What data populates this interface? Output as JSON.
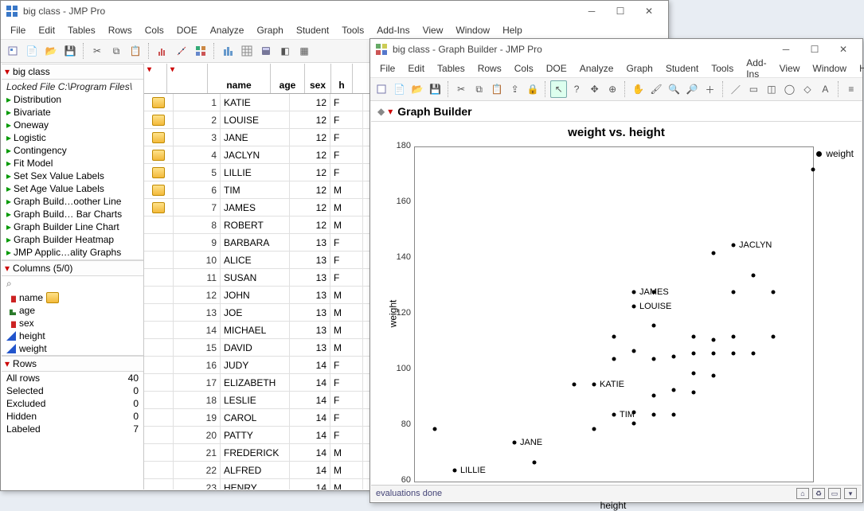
{
  "main_window": {
    "title": "big class - JMP Pro",
    "menus": [
      "File",
      "Edit",
      "Tables",
      "Rows",
      "Cols",
      "DOE",
      "Analyze",
      "Graph",
      "Student",
      "Tools",
      "Add-Ins",
      "View",
      "Window",
      "Help"
    ],
    "table_panel_title": "big class",
    "locked_note": "Locked File   C:\\Program Files\\",
    "scripts": [
      "Distribution",
      "Bivariate",
      "Oneway",
      "Logistic",
      "Contingency",
      "Fit Model",
      "Set Sex Value Labels",
      "Set Age Value Labels",
      "Graph Build…oother Line",
      "Graph Build… Bar Charts",
      "Graph Builder Line Chart",
      "Graph Builder Heatmap",
      "JMP Applic…ality Graphs"
    ],
    "columns_header": "Columns (5/0)",
    "columns": [
      {
        "name": "name",
        "type": "red",
        "label": true
      },
      {
        "name": "age",
        "type": "green"
      },
      {
        "name": "sex",
        "type": "red"
      },
      {
        "name": "height",
        "type": "blue"
      },
      {
        "name": "weight",
        "type": "blue"
      }
    ],
    "rows_header": "Rows",
    "row_stats": [
      {
        "k": "All rows",
        "v": "40"
      },
      {
        "k": "Selected",
        "v": "0"
      },
      {
        "k": "Excluded",
        "v": "0"
      },
      {
        "k": "Hidden",
        "v": "0"
      },
      {
        "k": "Labeled",
        "v": "7"
      }
    ],
    "grid_headers": [
      "name",
      "age",
      "sex",
      "h"
    ],
    "rows": [
      {
        "n": 1,
        "name": "KATIE",
        "age": 12,
        "sex": "F",
        "lab": true
      },
      {
        "n": 2,
        "name": "LOUISE",
        "age": 12,
        "sex": "F",
        "lab": true
      },
      {
        "n": 3,
        "name": "JANE",
        "age": 12,
        "sex": "F",
        "lab": true
      },
      {
        "n": 4,
        "name": "JACLYN",
        "age": 12,
        "sex": "F",
        "lab": true
      },
      {
        "n": 5,
        "name": "LILLIE",
        "age": 12,
        "sex": "F",
        "lab": true
      },
      {
        "n": 6,
        "name": "TIM",
        "age": 12,
        "sex": "M",
        "lab": true
      },
      {
        "n": 7,
        "name": "JAMES",
        "age": 12,
        "sex": "M",
        "lab": true
      },
      {
        "n": 8,
        "name": "ROBERT",
        "age": 12,
        "sex": "M"
      },
      {
        "n": 9,
        "name": "BARBARA",
        "age": 13,
        "sex": "F"
      },
      {
        "n": 10,
        "name": "ALICE",
        "age": 13,
        "sex": "F"
      },
      {
        "n": 11,
        "name": "SUSAN",
        "age": 13,
        "sex": "F"
      },
      {
        "n": 12,
        "name": "JOHN",
        "age": 13,
        "sex": "M"
      },
      {
        "n": 13,
        "name": "JOE",
        "age": 13,
        "sex": "M"
      },
      {
        "n": 14,
        "name": "MICHAEL",
        "age": 13,
        "sex": "M"
      },
      {
        "n": 15,
        "name": "DAVID",
        "age": 13,
        "sex": "M"
      },
      {
        "n": 16,
        "name": "JUDY",
        "age": 14,
        "sex": "F"
      },
      {
        "n": 17,
        "name": "ELIZABETH",
        "age": 14,
        "sex": "F"
      },
      {
        "n": 18,
        "name": "LESLIE",
        "age": 14,
        "sex": "F"
      },
      {
        "n": 19,
        "name": "CAROL",
        "age": 14,
        "sex": "F"
      },
      {
        "n": 20,
        "name": "PATTY",
        "age": 14,
        "sex": "F"
      },
      {
        "n": 21,
        "name": "FREDERICK",
        "age": 14,
        "sex": "M"
      },
      {
        "n": 22,
        "name": "ALFRED",
        "age": 14,
        "sex": "M"
      },
      {
        "n": 23,
        "name": "HENRY",
        "age": 14,
        "sex": "M"
      }
    ]
  },
  "gb_window": {
    "title": "big class - Graph Builder - JMP Pro",
    "menus": [
      "File",
      "Edit",
      "Tables",
      "Rows",
      "Cols",
      "DOE",
      "Analyze",
      "Graph",
      "Student",
      "Tools",
      "Add-Ins",
      "View",
      "Window",
      "Help"
    ],
    "outline_title": "Graph Builder",
    "status": "evaluations done",
    "legend": "weight"
  },
  "chart_data": {
    "type": "scatter",
    "title": "weight vs. height",
    "xlabel": "height",
    "ylabel": "weight",
    "xlim": [
      50,
      70
    ],
    "ylim": [
      60,
      180
    ],
    "xticks": [
      50,
      55,
      60,
      65,
      70
    ],
    "yticks": [
      60,
      80,
      100,
      120,
      140,
      160,
      180
    ],
    "points": [
      {
        "x": 59,
        "y": 95,
        "label": "KATIE"
      },
      {
        "x": 61,
        "y": 123,
        "label": "LOUISE"
      },
      {
        "x": 55,
        "y": 74,
        "label": "JANE"
      },
      {
        "x": 66,
        "y": 145,
        "label": "JACLYN"
      },
      {
        "x": 52,
        "y": 64,
        "label": "LILLIE"
      },
      {
        "x": 60,
        "y": 84,
        "label": "TIM"
      },
      {
        "x": 61,
        "y": 128,
        "label": "JAMES"
      },
      {
        "x": 51,
        "y": 79
      },
      {
        "x": 56,
        "y": 67
      },
      {
        "x": 58,
        "y": 95
      },
      {
        "x": 59,
        "y": 79
      },
      {
        "x": 60,
        "y": 104
      },
      {
        "x": 60,
        "y": 112
      },
      {
        "x": 61,
        "y": 85
      },
      {
        "x": 61,
        "y": 107
      },
      {
        "x": 61,
        "y": 81
      },
      {
        "x": 62,
        "y": 91
      },
      {
        "x": 62,
        "y": 104
      },
      {
        "x": 62,
        "y": 116
      },
      {
        "x": 62,
        "y": 84
      },
      {
        "x": 62,
        "y": 128
      },
      {
        "x": 63,
        "y": 105
      },
      {
        "x": 63,
        "y": 93
      },
      {
        "x": 63,
        "y": 84
      },
      {
        "x": 64,
        "y": 106
      },
      {
        "x": 64,
        "y": 92
      },
      {
        "x": 64,
        "y": 112
      },
      {
        "x": 64,
        "y": 99
      },
      {
        "x": 65,
        "y": 111
      },
      {
        "x": 65,
        "y": 98
      },
      {
        "x": 65,
        "y": 106
      },
      {
        "x": 65,
        "y": 142
      },
      {
        "x": 66,
        "y": 106
      },
      {
        "x": 66,
        "y": 112
      },
      {
        "x": 66,
        "y": 128
      },
      {
        "x": 67,
        "y": 106
      },
      {
        "x": 67,
        "y": 134
      },
      {
        "x": 68,
        "y": 112
      },
      {
        "x": 68,
        "y": 128
      },
      {
        "x": 70,
        "y": 172
      }
    ]
  }
}
